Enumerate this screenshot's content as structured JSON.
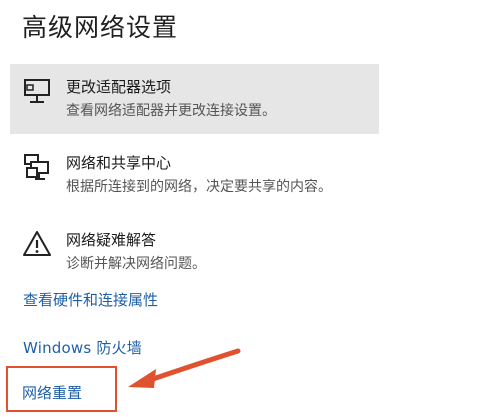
{
  "page": {
    "title": "高级网络设置"
  },
  "options": [
    {
      "id": "adapter",
      "icon": "monitor-icon",
      "title": "更改适配器选项",
      "description": "查看网络适配器并更改连接设置。",
      "selected": true
    },
    {
      "id": "sharing",
      "icon": "network-sharing-icon",
      "title": "网络和共享中心",
      "description": "根据所连接到的网络，决定要共享的内容。",
      "selected": false
    },
    {
      "id": "troubleshoot",
      "icon": "warning-icon",
      "title": "网络疑难解答",
      "description": "诊断并解决网络问题。",
      "selected": false
    }
  ],
  "links": {
    "hardware": "查看硬件和连接属性",
    "firewall": "Windows 防火墙",
    "reset": "网络重置"
  },
  "colors": {
    "link": "#1f5fa8",
    "selected_background": "#e6e6e6",
    "annotation": "#e0522f"
  }
}
